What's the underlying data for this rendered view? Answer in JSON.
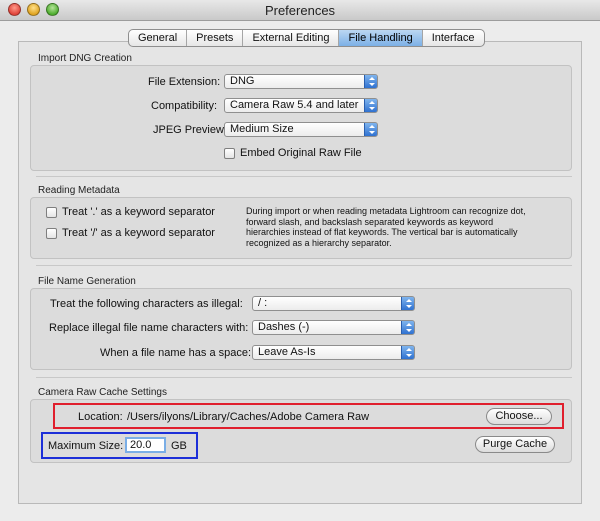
{
  "window": {
    "title": "Preferences"
  },
  "tabs": [
    {
      "label": "General"
    },
    {
      "label": "Presets"
    },
    {
      "label": "External Editing"
    },
    {
      "label": "File Handling"
    },
    {
      "label": "Interface"
    }
  ],
  "import_dng": {
    "title": "Import DNG Creation",
    "file_extension_label": "File Extension:",
    "file_extension_value": "DNG",
    "compatibility_label": "Compatibility:",
    "compatibility_value": "Camera Raw 5.4 and later",
    "jpeg_preview_label": "JPEG Preview:",
    "jpeg_preview_value": "Medium Size",
    "embed_raw_label": "Embed Original Raw File",
    "embed_raw_checked": false
  },
  "reading_metadata": {
    "title": "Reading Metadata",
    "dot_label": "Treat '.' as a keyword separator",
    "slash_label": "Treat '/' as a keyword separator",
    "description": "During import or when reading metadata Lightroom can recognize dot, forward slash, and backslash separated keywords as keyword hierarchies instead of flat keywords. The vertical bar is automatically recognized as a hierarchy separator."
  },
  "file_name_generation": {
    "title": "File Name Generation",
    "illegal_label": "Treat the following characters as illegal:",
    "illegal_value": "/ :",
    "replace_label": "Replace illegal file name characters with:",
    "replace_value": "Dashes (-)",
    "space_label": "When a file name has a space:",
    "space_value": "Leave As-Is"
  },
  "cache": {
    "title": "Camera Raw Cache Settings",
    "location_label": "Location:",
    "location_value": "/Users/ilyons/Library/Caches/Adobe Camera Raw",
    "choose_label": "Choose...",
    "max_size_label": "Maximum Size:",
    "max_size_value": "20.0",
    "max_size_unit": "GB",
    "purge_label": "Purge Cache"
  },
  "colors": {
    "highlight_red": "#e01f2d",
    "highlight_blue": "#1c2fd8",
    "tab_active": "#7cb0e6"
  }
}
